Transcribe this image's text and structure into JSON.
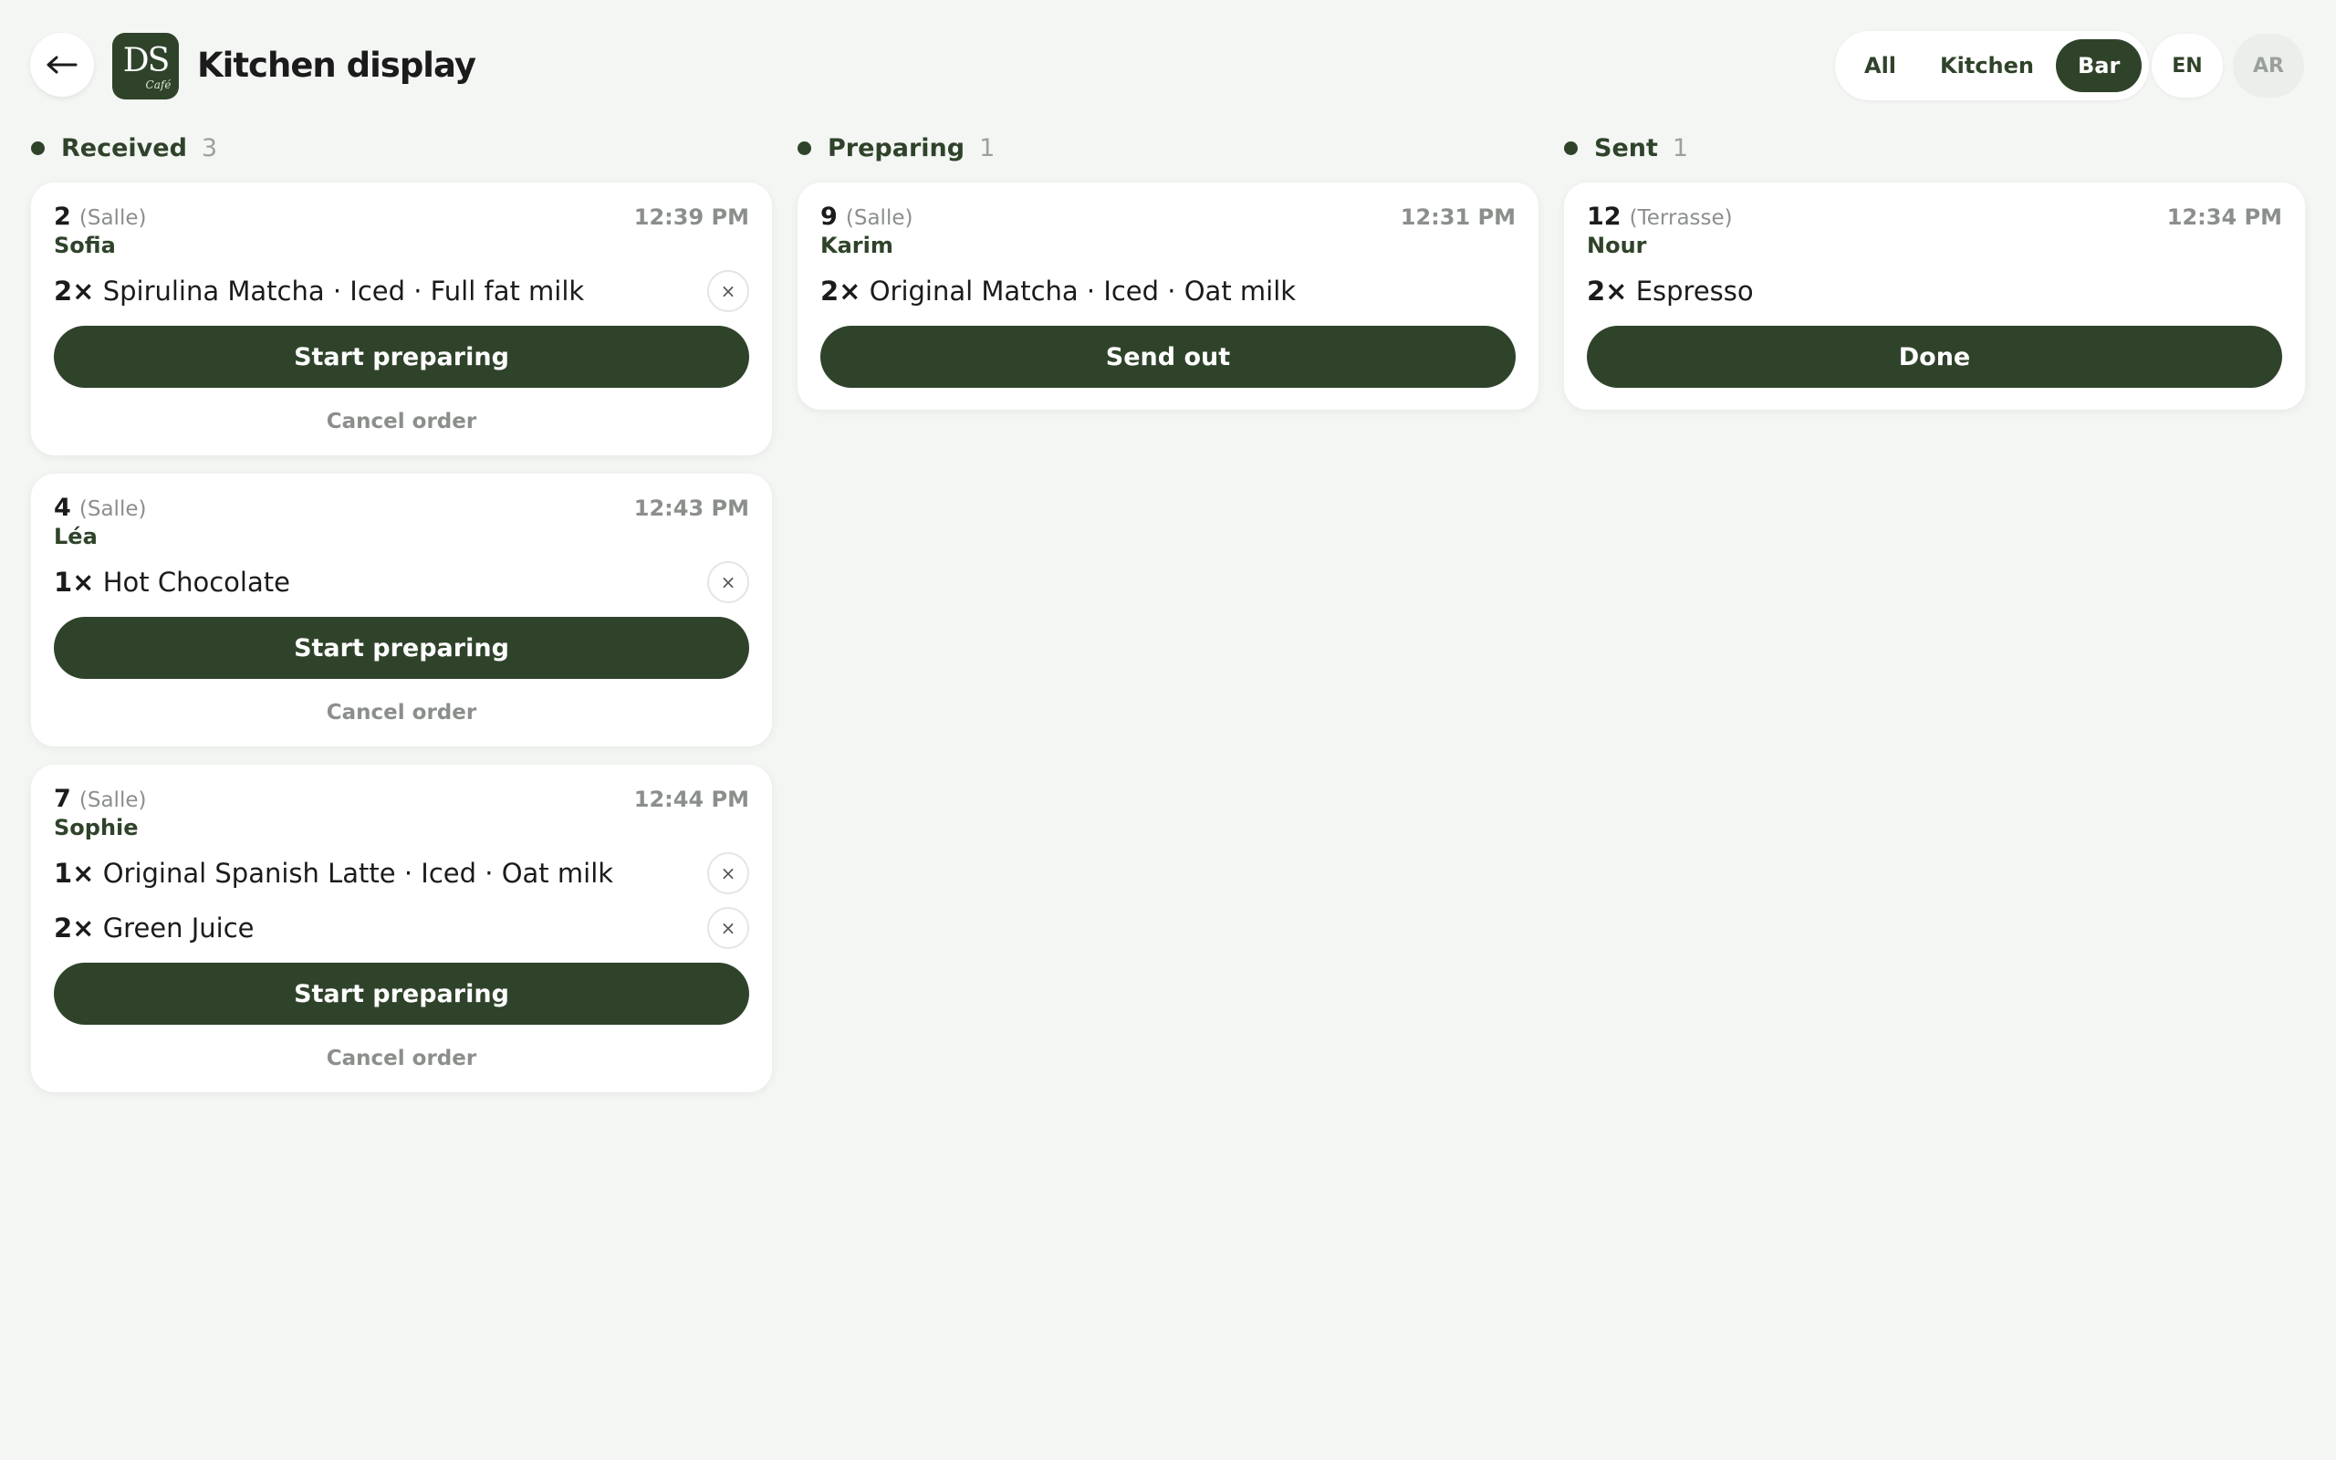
{
  "header": {
    "back_symbol": "←",
    "logo_mark": "DS",
    "logo_sub": "Café",
    "title": "Kitchen display",
    "filters": [
      "All",
      "Kitchen",
      "Bar"
    ],
    "active_filter": "Bar",
    "languages": [
      "EN",
      "AR"
    ],
    "active_language": "EN"
  },
  "colors": {
    "brand": "#2f432a",
    "background": "#f4f6f4",
    "muted": "#8b8f8b"
  },
  "columns": [
    {
      "title": "Received",
      "count": "3",
      "orders": [
        {
          "table": "2",
          "area": "(Salle)",
          "time": "12:39 PM",
          "customer": "Sofia",
          "items": [
            {
              "qty": "2×",
              "name": "Spirulina Matcha · Iced · Full fat milk",
              "removable": true
            }
          ],
          "action": "Start preparing",
          "cancel": "Cancel order"
        },
        {
          "table": "4",
          "area": "(Salle)",
          "time": "12:43 PM",
          "customer": "Léa",
          "items": [
            {
              "qty": "1×",
              "name": "Hot Chocolate",
              "removable": true
            }
          ],
          "action": "Start preparing",
          "cancel": "Cancel order"
        },
        {
          "table": "7",
          "area": "(Salle)",
          "time": "12:44 PM",
          "customer": "Sophie",
          "items": [
            {
              "qty": "1×",
              "name": "Original Spanish Latte · Iced · Oat milk",
              "removable": true
            },
            {
              "qty": "2×",
              "name": "Green Juice",
              "removable": true
            }
          ],
          "action": "Start preparing",
          "cancel": "Cancel order"
        }
      ]
    },
    {
      "title": "Preparing",
      "count": "1",
      "orders": [
        {
          "table": "9",
          "area": "(Salle)",
          "time": "12:31 PM",
          "customer": "Karim",
          "items": [
            {
              "qty": "2×",
              "name": "Original Matcha · Iced · Oat milk",
              "removable": false
            }
          ],
          "action": "Send out"
        }
      ]
    },
    {
      "title": "Sent",
      "count": "1",
      "orders": [
        {
          "table": "12",
          "area": "(Terrasse)",
          "time": "12:34 PM",
          "customer": "Nour",
          "items": [
            {
              "qty": "2×",
              "name": "Espresso",
              "removable": false
            }
          ],
          "action": "Done"
        }
      ]
    }
  ]
}
